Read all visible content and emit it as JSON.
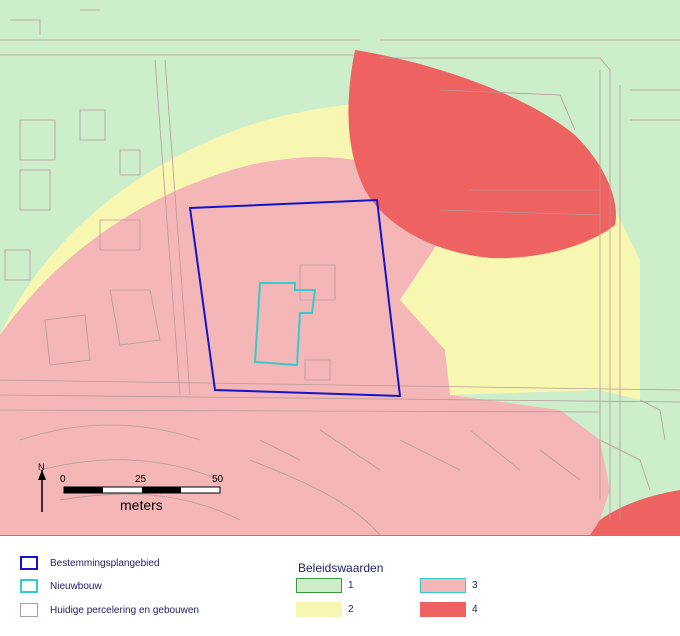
{
  "map": {
    "scale": {
      "tick0": "0",
      "tick1": "25",
      "tick2": "50",
      "unit": "meters",
      "north": "N"
    },
    "colors": {
      "zone1": "#cdeecb",
      "zone2": "#f8f7b2",
      "zone3": "#f4b6b6",
      "zone4": "#ee6262",
      "plan": "#1414c8",
      "nieuwbouw": "#33cccc",
      "parcel": "#b89a9a"
    }
  },
  "legend": {
    "items": [
      {
        "label": "Bestemmingsplangebied",
        "color": "#1414c8"
      },
      {
        "label": "Nieuwbouw",
        "color": "#33cccc"
      },
      {
        "label": "Huidige percelering en gebouwen",
        "color": "#b89a9a"
      }
    ],
    "beleid_title": "Beleidswaarden",
    "beleid": [
      {
        "label": "1",
        "fill": "#cdeecb",
        "stroke": "#3a9a3a"
      },
      {
        "label": "2",
        "fill": "#f8f7b2",
        "stroke": "#f8f7b2"
      },
      {
        "label": "3",
        "fill": "#f4b6b6",
        "stroke": "#33cccc"
      },
      {
        "label": "4",
        "fill": "#ee6262",
        "stroke": "#ee6262"
      }
    ]
  }
}
